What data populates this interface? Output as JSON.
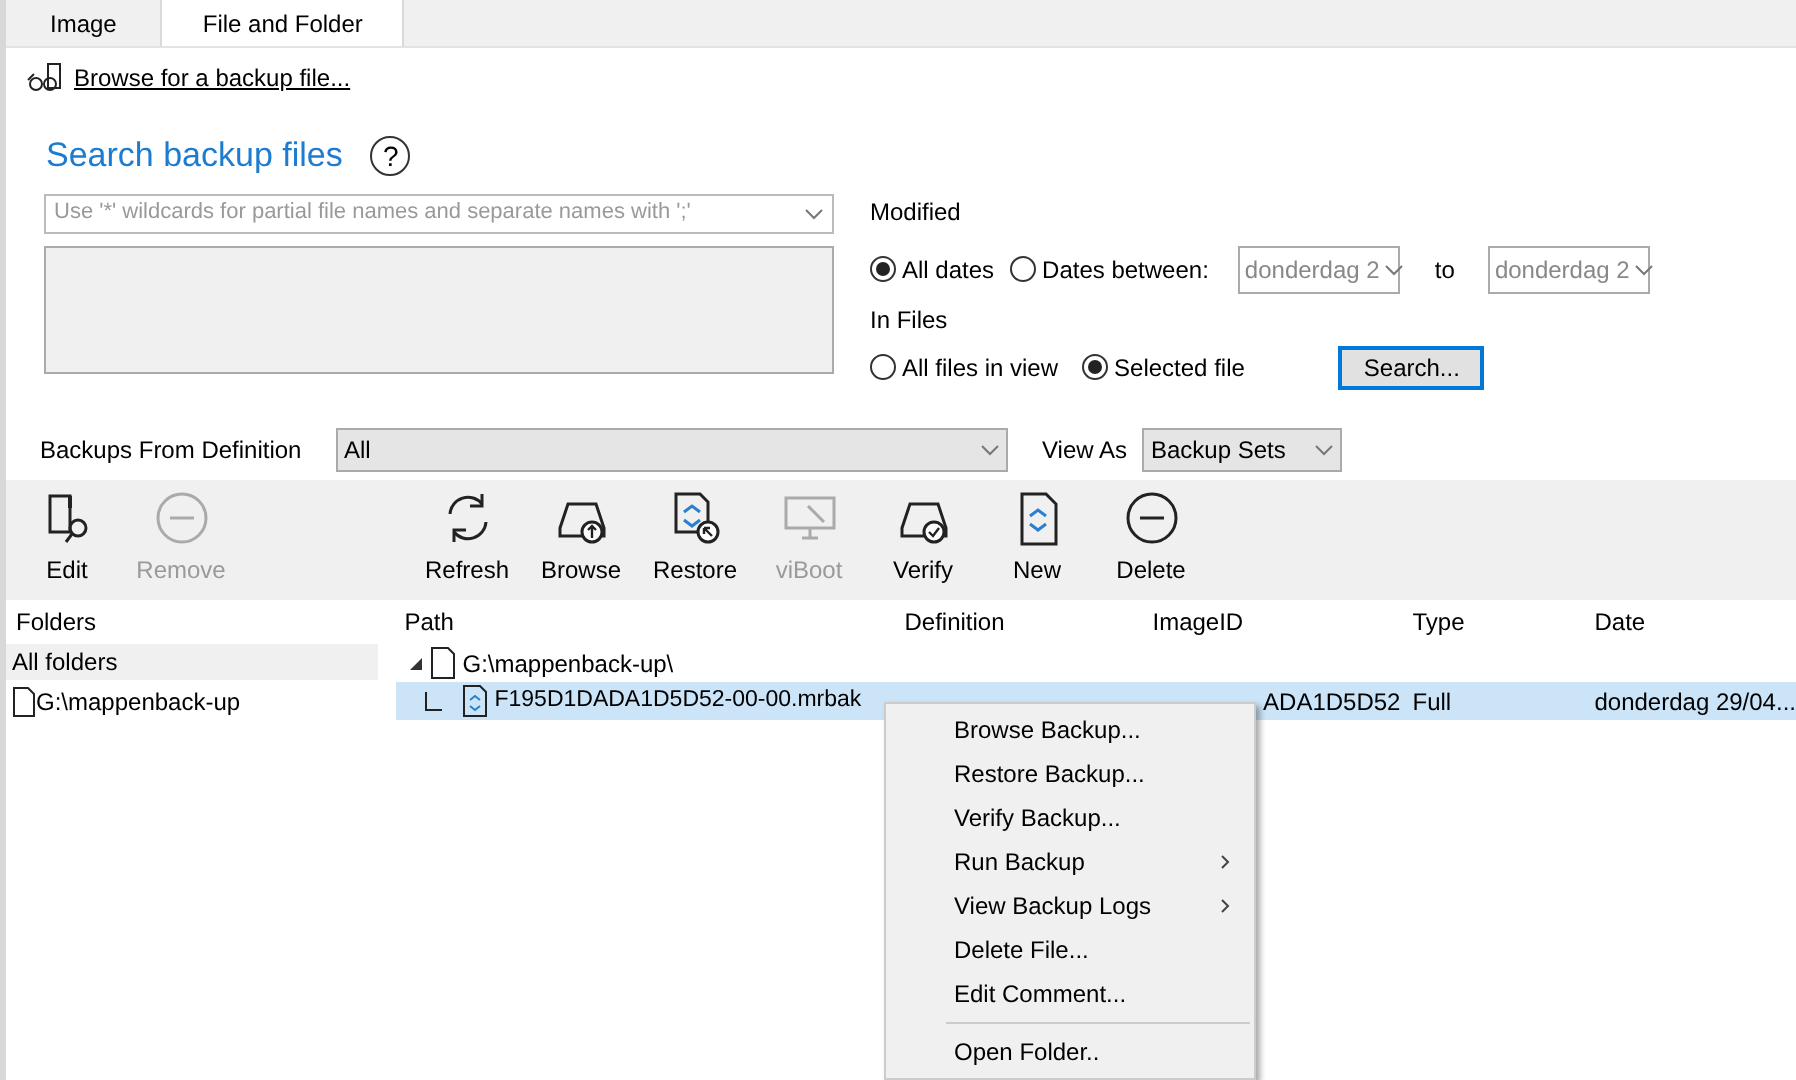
{
  "tabs": [
    {
      "label": "Image",
      "selected": false
    },
    {
      "label": "File and Folder",
      "selected": true
    }
  ],
  "browse_link": "Browse for a backup file...",
  "search": {
    "title": "Search backup files",
    "help": "?",
    "name_field": {
      "placeholder": "Use '*' wildcards for partial file names and separate names with ';'"
    },
    "modified": {
      "label": "Modified",
      "options": [
        {
          "label": "All dates",
          "selected": true
        },
        {
          "label": "Dates between:",
          "selected": false
        }
      ],
      "from": "donderdag 2",
      "to_label": "to",
      "to": "donderdag 2"
    },
    "in_files": {
      "label": "In Files",
      "options": [
        {
          "label": "All files in view",
          "selected": false
        },
        {
          "label": "Selected file",
          "selected": true
        }
      ]
    },
    "search_button": "Search..."
  },
  "filter": {
    "definition_label": "Backups From Definition",
    "definition": "All",
    "view_as_label": "View As",
    "view_as": "Backup Sets"
  },
  "toolbar": [
    {
      "label": "Edit",
      "kind": "edit",
      "disabled": false
    },
    {
      "label": "Remove",
      "kind": "minus",
      "disabled": true
    },
    {
      "label": "Refresh",
      "kind": "refresh",
      "disabled": false
    },
    {
      "label": "Browse",
      "kind": "browse",
      "disabled": false
    },
    {
      "label": "Restore",
      "kind": "restore",
      "disabled": false
    },
    {
      "label": "viBoot",
      "kind": "monitor",
      "disabled": true
    },
    {
      "label": "Verify",
      "kind": "verify",
      "disabled": false
    },
    {
      "label": "New",
      "kind": "new",
      "disabled": false
    },
    {
      "label": "Delete",
      "kind": "minus",
      "disabled": false
    }
  ],
  "folders": {
    "header": "Folders",
    "items": [
      {
        "label": "All folders",
        "selected": true,
        "kind": "all"
      },
      {
        "label": "G:\\mappenback-up",
        "selected": false,
        "kind": "folder"
      }
    ]
  },
  "table": {
    "columns": [
      "Path",
      "Definition",
      "ImageID",
      "Type",
      "Date"
    ],
    "tree": [
      {
        "path": "G:\\mappenback-up\\",
        "expanded": true,
        "children": [
          {
            "path": "F195D1DADA1D5D52-00-00.mrbak",
            "selected": true,
            "image_id": "ADA1D5D52",
            "type": "Full",
            "date": "donderdag 29/04..."
          }
        ]
      }
    ]
  },
  "context_menu": [
    {
      "label": "Browse Backup...",
      "submenu": false
    },
    {
      "label": "Restore Backup...",
      "submenu": false
    },
    {
      "label": "Verify Backup...",
      "submenu": false
    },
    {
      "label": "Run Backup",
      "submenu": true
    },
    {
      "label": "View Backup Logs",
      "submenu": true
    },
    {
      "label": "Delete File...",
      "submenu": false
    },
    {
      "label": "Edit Comment...",
      "submenu": false,
      "separator_after": true
    },
    {
      "label": "Open Folder..",
      "submenu": false
    }
  ]
}
